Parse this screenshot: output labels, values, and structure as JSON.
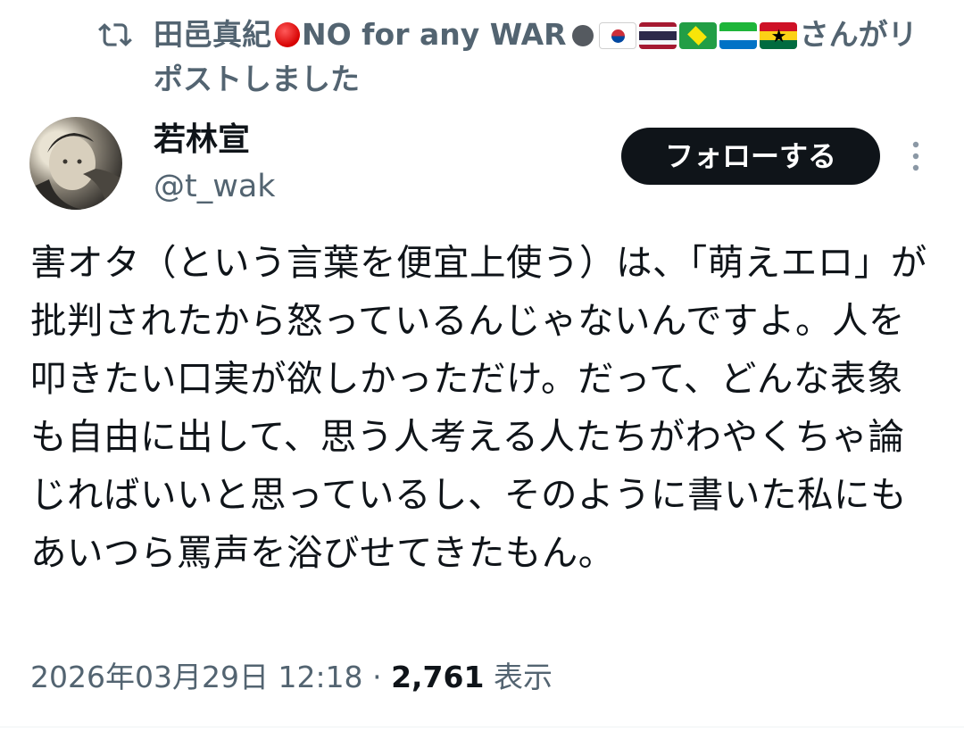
{
  "repost": {
    "icon": "repost-icon",
    "user_name": "田邑真紀",
    "name_suffix": "NO for any WAR",
    "flags": [
      "kr",
      "th",
      "br",
      "sl",
      "gh"
    ],
    "action_text": "さんがリポストしました"
  },
  "author": {
    "display_name": "若林宣",
    "handle": "@t_wak"
  },
  "follow_button": {
    "label": "フォローする"
  },
  "tweet": {
    "text": "害オタ（という言葉を便宜上使う）は、「萌えエロ」が批判されたから怒っているんじゃないんですよ。人を叩きたい口実が欲しかっただけ。だって、どんな表象も自由に出して、思う人考える人たちがわやくちゃ論じればいいと思っているし、そのように書いた私にもあいつら罵声を浴びせてきたもん。"
  },
  "meta": {
    "timestamp": "2026年03月29日 12:18",
    "separator": "·",
    "views_count": "2,761",
    "views_label": "表示"
  },
  "colors": {
    "text_primary": "#0f1419",
    "text_secondary": "#536471",
    "button_bg": "#0f1419",
    "button_text": "#ffffff"
  }
}
